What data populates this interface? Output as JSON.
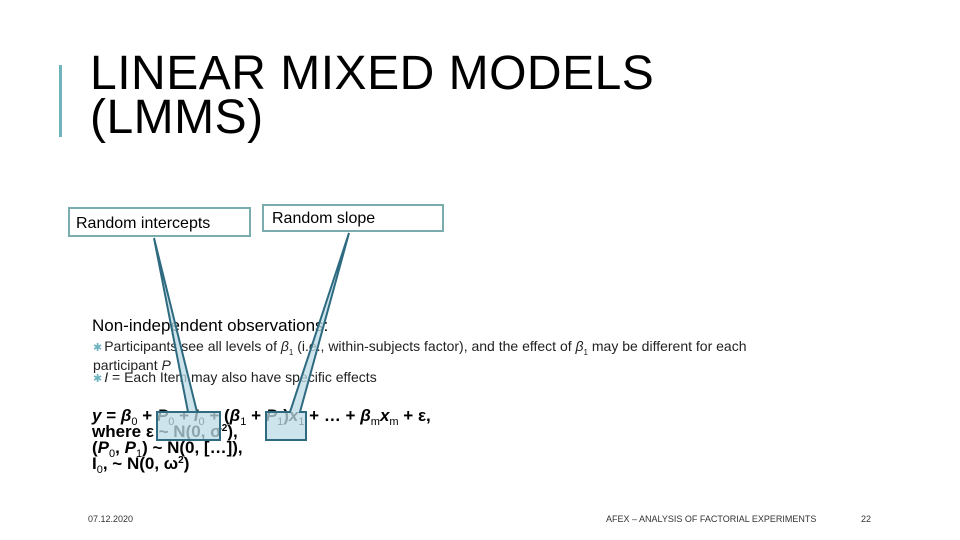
{
  "slide": {
    "title_line1": "LINEAR MIXED MODELS",
    "title_line2": "(LMMS)",
    "accent_color": "#6fb3bf",
    "callouts": [
      {
        "label": "Random intercepts",
        "target": "P0 + I0"
      },
      {
        "label": "Random slope",
        "target": "P1"
      }
    ],
    "heading": "Non-independent observations:",
    "bullets": [
      {
        "pre": "Participants see all levels of ",
        "sym": "β",
        "sym_sub": "1",
        "post": " (i.e., within-subjects factor), and the effect of ",
        "sym2": "β",
        "sym2_sub": "1",
        "post2": " may be different for each participant ",
        "var": "P"
      },
      {
        "var": "I",
        "text": " = Each Item may also have specific effects"
      }
    ],
    "formula": {
      "line1": {
        "y": "y",
        "eq": " = ",
        "b0": "β",
        "b0_sub": "0",
        "plus1": " + ",
        "p0": "P",
        "p0_sub": "0",
        "plus2": " + ",
        "i0": "I",
        "i0_sub": "0",
        "plus3": " + (",
        "b1": "β",
        "b1_sub": "1",
        "plus4": " + ",
        "p1": "P",
        "p1_sub": "1",
        "close": ")",
        "x1": "x",
        "x1_sub": "1",
        "dots": " + … + ",
        "bm": "β",
        "bm_sub": "m",
        "xm": "x",
        "xm_sub": "m",
        "tail": " + ε,"
      },
      "line2": {
        "text": "where ε ~ N(0, σ",
        "sup": "2",
        "end": "),"
      },
      "line3": {
        "pre": "(",
        "p0": "P",
        "p0_sub": "0",
        "comma": ", ",
        "p1": "P",
        "p1_sub": "1",
        "end": ") ~ N(0, […]),"
      },
      "line4": {
        "i": "I",
        "i_sub": "0",
        "end": ", ~ N(0, ω",
        "sup": "2",
        "end2": ")"
      }
    },
    "footer": {
      "date": "07.12.2020",
      "title": "AFEX – ANALYSIS OF FACTORIAL EXPERIMENTS",
      "page": "22"
    }
  }
}
